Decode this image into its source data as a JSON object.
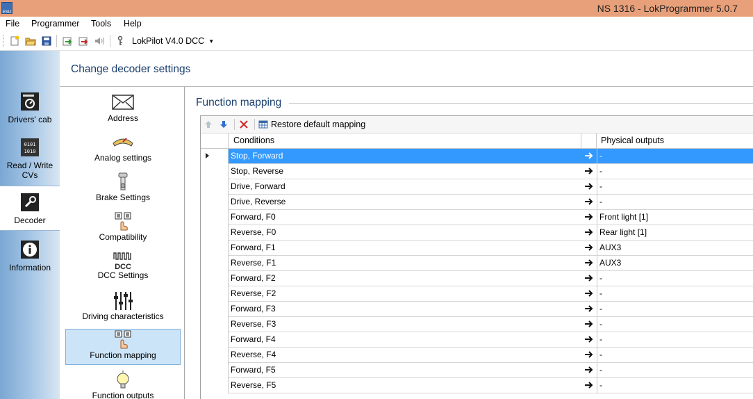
{
  "window": {
    "title": "NS 1316 - LokProgrammer 5.0.7",
    "app_icon_text": "ESU"
  },
  "menu": [
    "File",
    "Programmer",
    "Tools",
    "Help"
  ],
  "toolbar": {
    "decoder_type": "LokPilot V4.0 DCC",
    "icons": [
      "new-file-icon",
      "open-folder-icon",
      "save-icon",
      "read-decoder-icon",
      "write-decoder-icon",
      "sound-icon",
      "key-icon"
    ]
  },
  "nav": {
    "items": [
      {
        "label": "Drivers' cab",
        "icon": "drivers-cab-icon"
      },
      {
        "label": "Read / Write CVs",
        "icon": "cv-binary-icon"
      },
      {
        "label": "Decoder",
        "icon": "wrench-icon",
        "active": true
      },
      {
        "label": "Information",
        "icon": "info-icon"
      }
    ]
  },
  "header": {
    "title": "Change decoder settings"
  },
  "subnav": {
    "items": [
      {
        "label": "Address",
        "icon": "envelope-icon"
      },
      {
        "label": "Analog settings",
        "icon": "analog-gauge-icon"
      },
      {
        "label": "Brake Settings",
        "icon": "brake-icon"
      },
      {
        "label": "Compatibility",
        "icon": "hand-switch-icon"
      },
      {
        "label": "DCC Settings",
        "icon": "dcc-signal-icon",
        "icon_text": "DCC"
      },
      {
        "label": "Driving characteristics",
        "icon": "sliders-icon"
      },
      {
        "label": "Function mapping",
        "icon": "function-hand-icon",
        "active": true
      },
      {
        "label": "Function outputs",
        "icon": "light-bulb-icon"
      }
    ]
  },
  "main": {
    "section_title": "Function mapping",
    "grid_toolbar": {
      "restore_label": "Restore default mapping",
      "icons": [
        "move-up-icon",
        "move-down-icon",
        "delete-icon",
        "table-icon"
      ]
    },
    "columns": {
      "conditions": "Conditions",
      "outputs": "Physical outputs"
    },
    "rows": [
      {
        "condition": "Stop, Forward",
        "output": "-",
        "selected": true
      },
      {
        "condition": "Stop, Reverse",
        "output": "-"
      },
      {
        "condition": "Drive, Forward",
        "output": "-"
      },
      {
        "condition": "Drive, Reverse",
        "output": "-"
      },
      {
        "condition": "Forward, F0",
        "output": "Front light [1]"
      },
      {
        "condition": "Reverse, F0",
        "output": "Rear light [1]"
      },
      {
        "condition": "Forward, F1",
        "output": "AUX3"
      },
      {
        "condition": "Reverse, F1",
        "output": "AUX3"
      },
      {
        "condition": "Forward, F2",
        "output": "-"
      },
      {
        "condition": "Reverse, F2",
        "output": "-"
      },
      {
        "condition": "Forward, F3",
        "output": "-"
      },
      {
        "condition": "Reverse, F3",
        "output": "-"
      },
      {
        "condition": "Forward, F4",
        "output": "-"
      },
      {
        "condition": "Reverse, F4",
        "output": "-"
      },
      {
        "condition": "Forward, F5",
        "output": "-"
      },
      {
        "condition": "Reverse, F5",
        "output": "-"
      }
    ]
  },
  "colors": {
    "titlebar": "#e8a07a",
    "selection": "#3399ff",
    "subnav_active": "#cce4f7",
    "heading": "#1c3f6e"
  }
}
